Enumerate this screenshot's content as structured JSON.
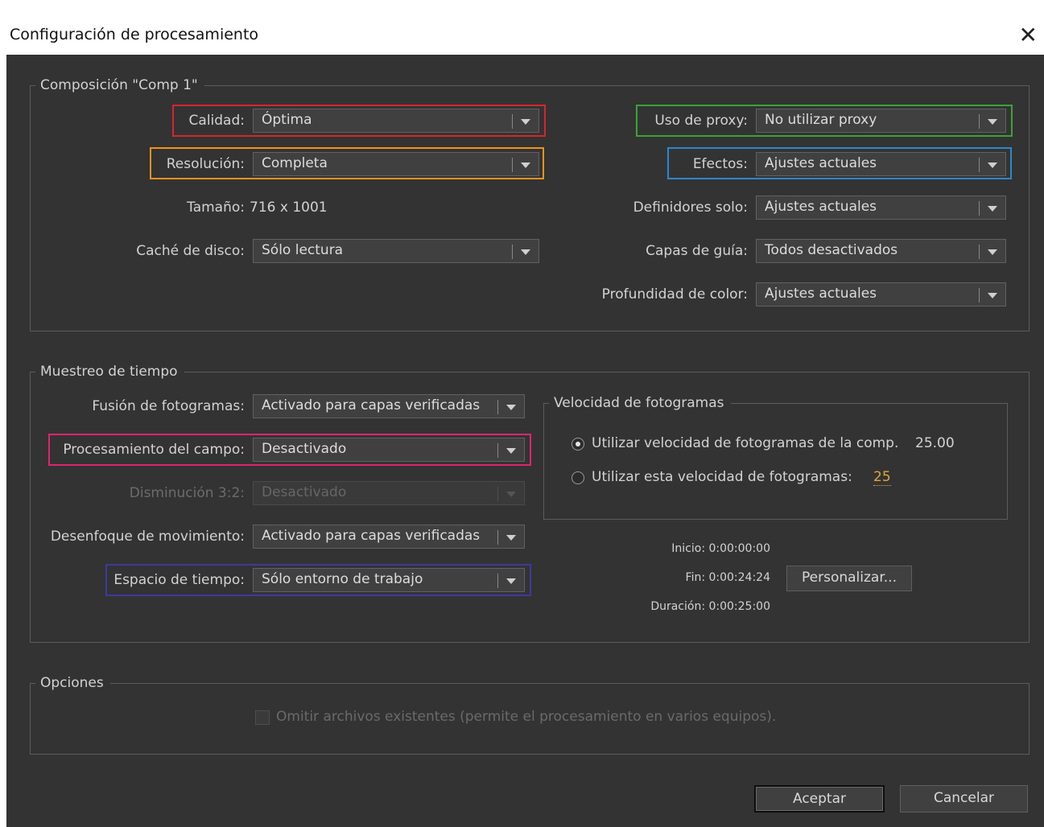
{
  "window": {
    "title": "Configuración de procesamiento"
  },
  "composition": {
    "legend": "Composición \"Comp 1\"",
    "quality_label": "Calidad:",
    "quality_value": "Óptima",
    "resolution_label": "Resolución:",
    "resolution_value": "Completa",
    "size_label": "Tamaño:",
    "size_value": "716 x 1001",
    "disk_cache_label": "Caché de disco:",
    "disk_cache_value": "Sólo lectura",
    "proxy_label": "Uso de proxy:",
    "proxy_value": "No utilizar proxy",
    "effects_label": "Efectos:",
    "effects_value": "Ajustes actuales",
    "solo_label": "Definidores solo:",
    "solo_value": "Ajustes actuales",
    "guide_layers_label": "Capas de guía:",
    "guide_layers_value": "Todos desactivados",
    "color_depth_label": "Profundidad de color:",
    "color_depth_value": "Ajustes actuales"
  },
  "time_sampling": {
    "legend": "Muestreo de tiempo",
    "frame_blending_label": "Fusión de fotogramas:",
    "frame_blending_value": "Activado para capas verificadas",
    "field_render_label": "Procesamiento del campo:",
    "field_render_value": "Desactivado",
    "pulldown_label": "Disminución 3:2:",
    "pulldown_value": "Desactivado",
    "motion_blur_label": "Desenfoque de movimiento:",
    "motion_blur_value": "Activado para capas verificadas",
    "time_span_label": "Espacio de tiempo:",
    "time_span_value": "Sólo entorno de trabajo",
    "frame_rate": {
      "legend": "Velocidad de fotogramas",
      "use_comp_label": "Utilizar velocidad de fotogramas de la comp.",
      "comp_rate_value": "25.00",
      "use_custom_label": "Utilizar esta velocidad de fotogramas:",
      "custom_rate_value": "25"
    },
    "start": "Inicio: 0:00:00:00",
    "end": "Fin: 0:00:24:24",
    "duration": "Duración: 0:00:25:00",
    "custom_button": "Personalizar..."
  },
  "options": {
    "legend": "Opciones",
    "skip_files_label": "Omitir archivos existentes (permite el procesamiento en varios equipos)."
  },
  "buttons": {
    "ok": "Aceptar",
    "cancel": "Cancelar"
  },
  "highlight_colors": {
    "quality": "#d9242f",
    "resolution": "#f0921e",
    "proxy": "#3aa336",
    "effects": "#2f86cc",
    "field_render": "#e0246e",
    "time_span": "#3d3a9e"
  }
}
